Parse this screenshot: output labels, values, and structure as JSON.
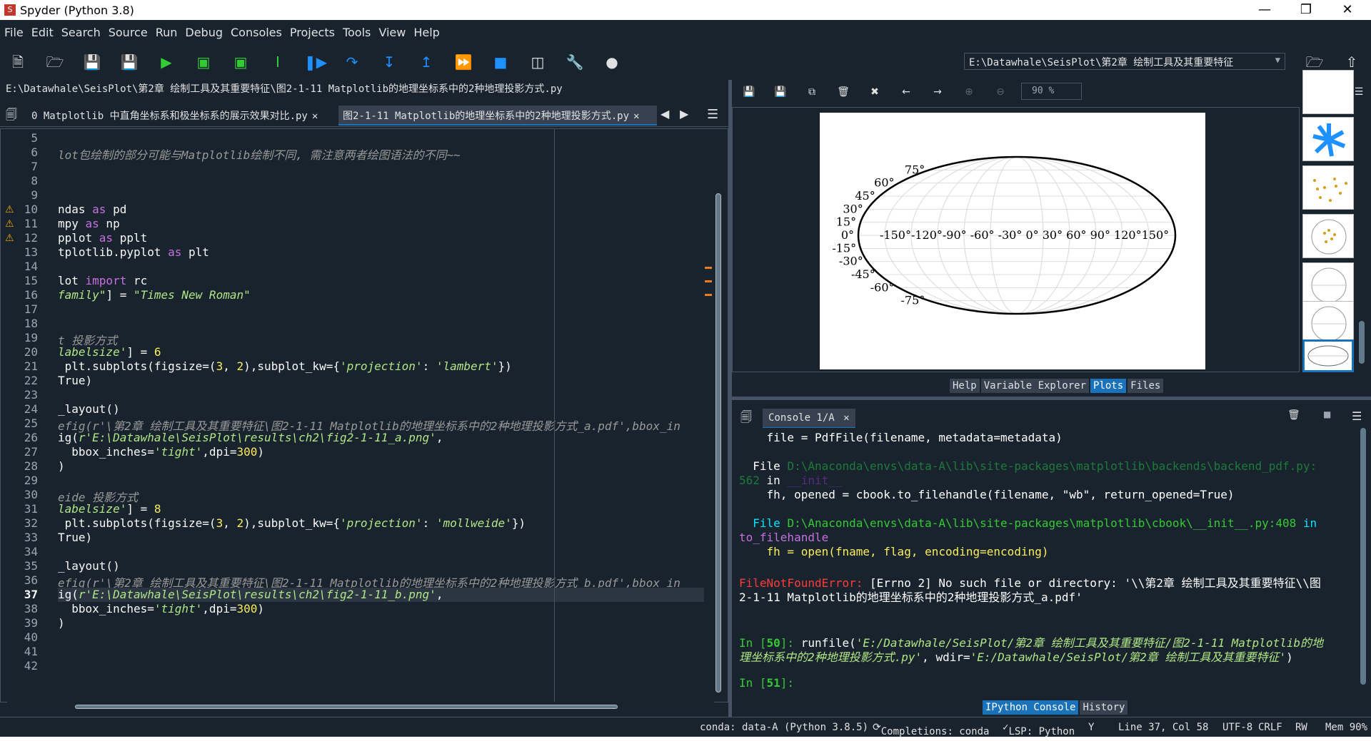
{
  "window": {
    "title": "Spyder (Python 3.8)"
  },
  "menu": [
    "File",
    "Edit",
    "Search",
    "Source",
    "Run",
    "Debug",
    "Consoles",
    "Projects",
    "Tools",
    "View",
    "Help"
  ],
  "working_dir": "E:\\Datawhale\\SeisPlot\\第2章 绘制工具及其重要特征",
  "editor": {
    "path": "E:\\Datawhale\\SeisPlot\\第2章 绘制工具及其重要特征\\图2-1-11 Matplotlib的地理坐标系中的2种地理投影方式.py",
    "tabs": [
      {
        "label": "0 Matplotlib 中直角坐标系和极坐标系的展示效果对比.py",
        "close": "✕"
      },
      {
        "label": "图2-1-11 Matplotlib的地理坐标系中的2种地理投影方式.py",
        "close": "✕"
      }
    ],
    "line_numbers": [
      "5",
      "6",
      "7",
      "8",
      "9",
      "10",
      "11",
      "12",
      "13",
      "14",
      "15",
      "16",
      "17",
      "18",
      "19",
      "20",
      "21",
      "22",
      "23",
      "24",
      "25",
      "26",
      "27",
      "28",
      "29",
      "30",
      "31",
      "32",
      "33",
      "34",
      "35",
      "36",
      "37",
      "38",
      "39",
      "40",
      "41",
      "42"
    ],
    "lines": {
      "l6": "lot包绘制的部分可能与Matplotlib绘制不同, 需注意两者绘图语法的不同~~",
      "l10a": "ndas ",
      "l10b": "as",
      "l10c": " pd",
      "l11a": "mpy ",
      "l11b": "as",
      "l11c": " np",
      "l12a": "pplot ",
      "l12b": "as",
      "l12c": " pplt",
      "l13a": "tplotlib.pyplot ",
      "l13b": "as",
      "l13c": " plt",
      "l15a": "lot ",
      "l15b": "import",
      "l15c": " rc",
      "l16a": "family\"",
      "l16b": "] = ",
      "l16c": "\"Times New Roman\"",
      "l19": "t 投影方式",
      "l20a": "labelsize'",
      "l20b": "] = ",
      "l20c": "6",
      "l21a": " plt.subplots(figsize=(",
      "l21b": "3",
      "l21c": ", ",
      "l21d": "2",
      "l21e": "),subplot_kw={",
      "l21f": "'projection'",
      "l21g": ": ",
      "l21h": "'lambert'",
      "l21i": "})",
      "l22": "True)",
      "l24": "_layout()",
      "l25": "efig(r'\\第2章 绘制工具及其重要特征\\图2-1-11 Matplotlib的地理坐标系中的2种地理投影方式_a.pdf',bbox_in",
      "l26a": "ig(",
      "l26b": "r'E:\\Datawhale\\SeisPlot\\results\\ch2\\fig2-1-11_a.png'",
      "l26c": ",",
      "l27a": "  bbox_inches=",
      "l27b": "'tight'",
      "l27c": ",dpi=",
      "l27d": "300",
      "l27e": ")",
      "l28": ")",
      "l30": "eide 投影方式",
      "l31a": "labelsize'",
      "l31b": "] = ",
      "l31c": "8",
      "l32a": " plt.subplots(figsize=(",
      "l32b": "3",
      "l32c": ", ",
      "l32d": "2",
      "l32e": "),subplot_kw={",
      "l32f": "'projection'",
      "l32g": ": ",
      "l32h": "'mollweide'",
      "l32i": "})",
      "l33": "True)",
      "l35": "_layout()",
      "l36": "efig(r'\\第2章 绘制工具及其重要特征\\图2-1-11 Matplotlib的地理坐标系中的2种地理投影方式_b.pdf',bbox_in",
      "l37a": "ig(",
      "l37b": "r'E:\\Datawhale\\SeisPlot\\results\\ch2\\fig2-1-11_b.png'",
      "l37c": ",",
      "l38a": "  bbox_inches=",
      "l38b": "'tight'",
      "l38c": ",dpi=",
      "l38d": "300",
      "l38e": ")",
      "l39": ")"
    }
  },
  "plots": {
    "zoom": "90 %",
    "lat_labels": [
      "75°",
      "60°",
      "45°",
      "30°",
      "15°",
      "0°",
      "-15°",
      "-30°",
      "-45°",
      "-60°",
      "-75°"
    ],
    "lon_labels": "-150°-120°-90° -60° -30°  0°  30°  60°  90°  120°150°"
  },
  "pane_tabs_top": [
    "Help",
    "Variable Explorer",
    "Plots",
    "Files"
  ],
  "console": {
    "tab": "Console 1/A",
    "lines": {
      "c1": "    file = PdfFile(filename, metadata=metadata)",
      "c2a": "  File ",
      "c2b": "D:\\Anaconda\\envs\\data-A\\lib\\site-packages\\matplotlib\\backends\\backend_pdf.py:",
      "c3a": "562",
      "c3b": " in ",
      "c3c": "__init__",
      "c4": "    fh, opened = cbook.to_filehandle(filename, \"wb\", return_opened=True)",
      "c5a": "  File ",
      "c5b": "D:\\Anaconda\\envs\\data-A\\lib\\site-packages\\matplotlib\\cbook\\__init__.py:408",
      "c5c": " in",
      "c6": "to_filehandle",
      "c7": "    fh = open(fname, flag, encoding=encoding)",
      "c8a": "FileNotFoundError:",
      "c8b": " [Errno 2] No such file or directory: '\\\\第2章 绘制工具及其重要特征\\\\图",
      "c9": "2-1-11 Matplotlib的地理坐标系中的2种地理投影方式_a.pdf'",
      "c10a": "In [",
      "c10b": "50",
      "c10c": "]: ",
      "c10d": "runfile(",
      "c10e": "'E:/Datawhale/SeisPlot/第2章 绘制工具及其重要特征/图2-1-11 Matplotlib的地",
      "c11a": "理坐标系中的2种地理投影方式.py'",
      "c11b": ", wdir=",
      "c11c": "'E:/Datawhale/SeisPlot/第2章 绘制工具及其重要特征'",
      "c11d": ")",
      "c12a": "In [",
      "c12b": "51",
      "c12c": "]:"
    }
  },
  "pane_tabs_bottom": [
    "IPython Console",
    "History"
  ],
  "status": {
    "conda": "conda: data-A (Python 3.8.5)",
    "completions": "Completions: conda",
    "lsp": "LSP: Python",
    "pos": "Line 37, Col 58",
    "encoding": "UTF-8",
    "eol": "CRLF",
    "rw": "RW",
    "mem": "Mem 90%"
  }
}
